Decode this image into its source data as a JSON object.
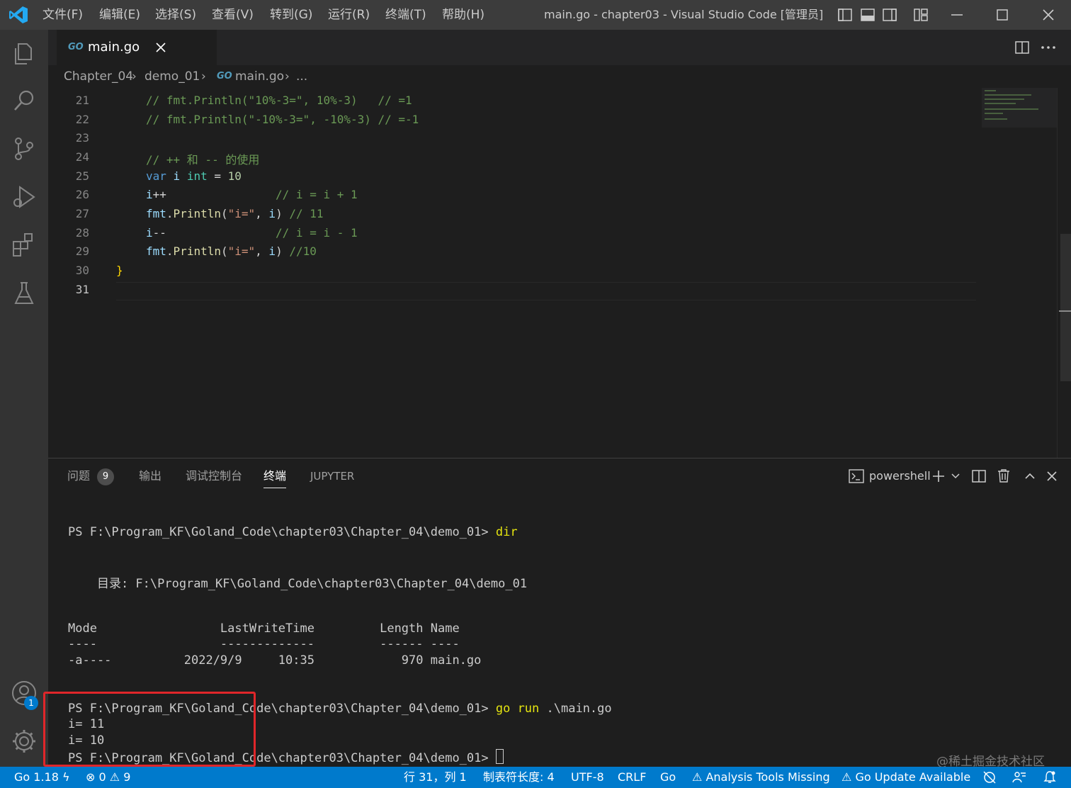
{
  "titlebar": {
    "menus": [
      "文件(F)",
      "编辑(E)",
      "选择(S)",
      "查看(V)",
      "转到(G)",
      "运行(R)",
      "终端(T)",
      "帮助(H)"
    ],
    "window_title": "main.go - chapter03 - Visual Studio Code [管理员]"
  },
  "tab": {
    "icon_text": "GO",
    "label": "main.go"
  },
  "breadcrumb": {
    "parts": [
      "Chapter_04",
      "demo_01",
      "main.go",
      "..."
    ],
    "file_icon": "GO"
  },
  "editor": {
    "line_numbers": [
      "21",
      "22",
      "23",
      "24",
      "25",
      "26",
      "27",
      "28",
      "29",
      "30",
      "31"
    ],
    "current_line": "31"
  },
  "panel": {
    "tabs": [
      "问题",
      "输出",
      "调试控制台",
      "终端",
      "JUPYTER"
    ],
    "problems_count": "9",
    "active_tab": "终端",
    "shell_label": "powershell",
    "terminal": {
      "prompt1": "PS F:\\Program_KF\\Goland_Code\\chapter03\\Chapter_04\\demo_01> ",
      "cmd1": "dir",
      "dir_header": "    目录: F:\\Program_KF\\Goland_Code\\chapter03\\Chapter_04\\demo_01",
      "table_header": "Mode                 LastWriteTime         Length Name",
      "table_rule": "----                 -------------         ------ ----",
      "table_row": "-a----          2022/9/9     10:35            970 main.go",
      "prompt2": "PS F:\\Program_KF\\Goland_Code\\chapter03\\Chapter_04\\demo_01> ",
      "cmd2": "go run",
      "cmd2_arg": " .\\main.go",
      "out1": "i= 11",
      "out2": "i= 10",
      "prompt3": "PS F:\\Program_KF\\Goland_Code\\chapter03\\Chapter_04\\demo_01> "
    }
  },
  "activity": {
    "accounts_badge": "1"
  },
  "statusbar": {
    "go_version": "Go 1.18",
    "errors": "0",
    "warnings": "9",
    "position": "行 31，列 1",
    "tab_size": "制表符长度: 4",
    "encoding": "UTF-8",
    "eol": "CRLF",
    "language": "Go",
    "analysis": "Analysis Tools Missing",
    "update": "Go Update Available"
  },
  "watermark": "@稀土掘金技术社区",
  "colors": {
    "accent": "#007acc",
    "highlight_box": "#e0262a"
  }
}
